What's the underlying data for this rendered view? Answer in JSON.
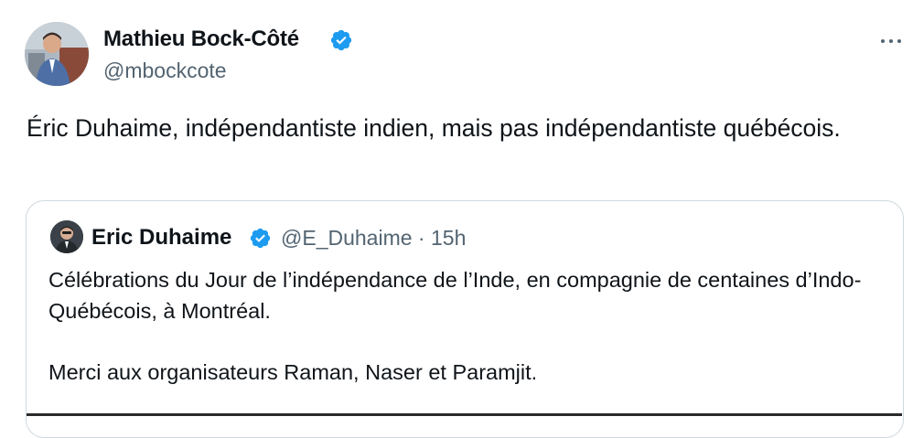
{
  "tweet": {
    "author": {
      "name": "Mathieu Bock-Côté",
      "handle": "@mbockcote",
      "verified": true
    },
    "more_icon": "more-horizontal-icon",
    "text": "Éric Duhaime, indépendantiste indien, mais pas indépendantiste québécois."
  },
  "quoted_tweet": {
    "author": {
      "name": "Eric Duhaime",
      "handle": "@E_Duhaime",
      "verified": true
    },
    "time": "15h",
    "separator": "·",
    "text": "Célébrations du Jour de l’indépendance de l’Inde, en compagnie de centaines d’Indo-Québécois, à Montréal.\n\nMerci aux organisateurs Raman, Naser et Paramjit."
  },
  "colors": {
    "verified": "#1d9bf0",
    "secondary_text": "#536471",
    "border": "#cfd9de"
  }
}
